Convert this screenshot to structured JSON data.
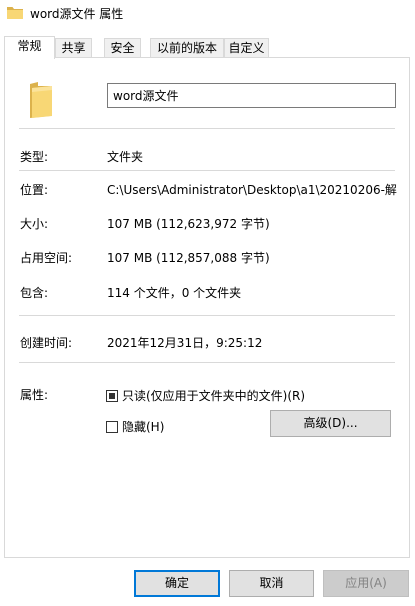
{
  "window": {
    "title": "word源文件 属性",
    "title_icon": "folder-icon"
  },
  "tabs": [
    {
      "label": "常规",
      "active": true
    },
    {
      "label": "共享",
      "active": false
    },
    {
      "label": "安全",
      "active": false
    },
    {
      "label": "以前的版本",
      "active": false
    },
    {
      "label": "自定义",
      "active": false
    }
  ],
  "general": {
    "icon": "folder-icon",
    "name_value": "word源文件",
    "type_label": "类型:",
    "type_value": "文件夹",
    "location_label": "位置:",
    "location_value": "C:\\Users\\Administrator\\Desktop\\a1\\20210206-解",
    "size_label": "大小:",
    "size_value": "107 MB (112,623,972 字节)",
    "size_on_disk_label": "占用空间:",
    "size_on_disk_value": "107 MB (112,857,088 字节)",
    "contains_label": "包含:",
    "contains_value": "114 个文件，0 个文件夹",
    "created_label": "创建时间:",
    "created_value": "2021年12月31日，9:25:12",
    "attributes_label": "属性:",
    "readonly_label": "只读(仅应用于文件夹中的文件)(R)",
    "readonly_state": "indeterminate",
    "hidden_label": "隐藏(H)",
    "hidden_state": "unchecked",
    "advanced_button": "高级(D)..."
  },
  "footer": {
    "ok_button": "确定",
    "cancel_button": "取消",
    "apply_button": "应用(A)"
  },
  "colors": {
    "accent": "#0078d7",
    "folder": "#f8d775",
    "border": "#d9d9d9",
    "button_bg": "#e1e1e1",
    "disabled_text": "#838383"
  }
}
